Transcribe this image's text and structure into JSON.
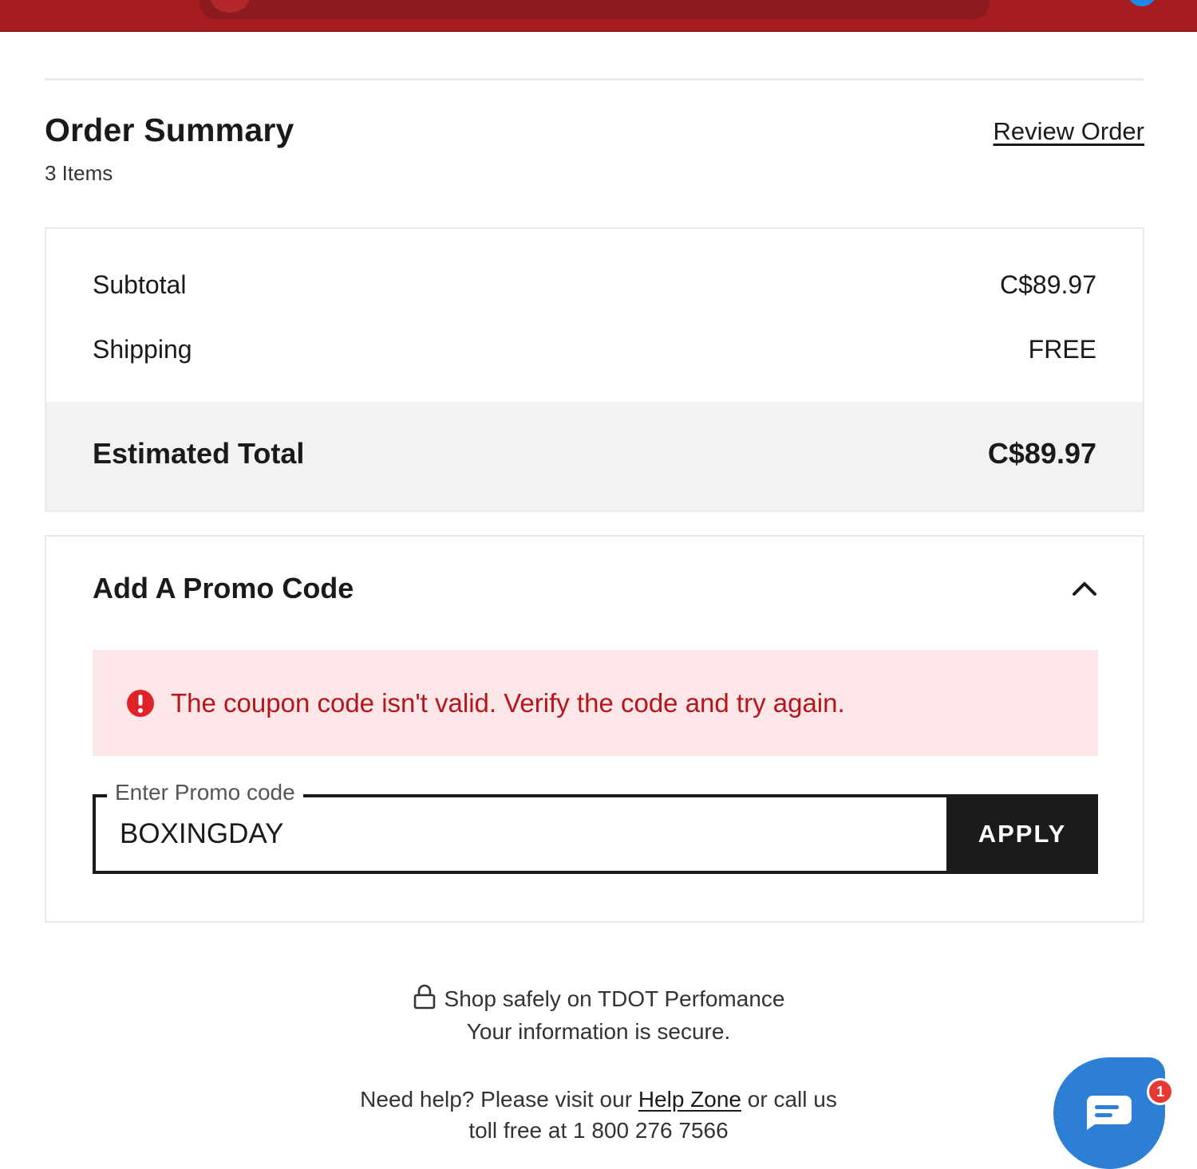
{
  "colors": {
    "brand_red": "#a51c1f",
    "error_bg": "#fde6e8",
    "error_text": "#b4161c",
    "button_dark": "#1b1b1b",
    "chat_blue": "#2c7fd4"
  },
  "summary": {
    "title": "Order Summary",
    "item_count": "3 Items",
    "review_link": "Review Order",
    "subtotal_label": "Subtotal",
    "subtotal_value": "C$89.97",
    "shipping_label": "Shipping",
    "shipping_value": "FREE",
    "total_label": "Estimated Total",
    "total_value": "C$89.97"
  },
  "promo": {
    "heading": "Add A Promo Code",
    "expanded": true,
    "error_message": "The coupon code isn't valid. Verify the code and try again.",
    "field_label": "Enter Promo code",
    "field_value": "BOXINGDAY",
    "apply_label": "APPLY"
  },
  "footer": {
    "secure_line1": "Shop safely on TDOT Perfomance",
    "secure_line2": "Your information is secure.",
    "help_prefix": "Need help? Please visit our",
    "help_link": "Help Zone",
    "help_suffix": "or call us",
    "help_phone_line": "toll free at 1 800 276 7566"
  },
  "chat": {
    "badge_count": "1",
    "icon": "chat-bubble-icon"
  }
}
